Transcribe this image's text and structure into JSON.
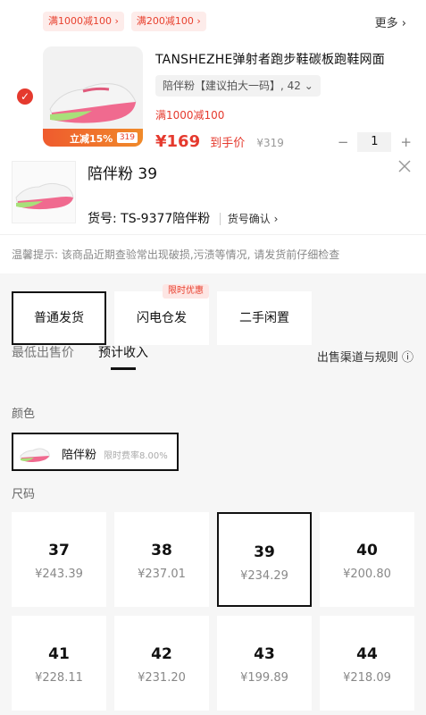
{
  "cart": {
    "coupons": [
      "满1000减100 ›",
      "满200减100 ›"
    ],
    "more_label": "更多 ›",
    "product_title": "TANSHEZHE弹射者跑步鞋碳板跑鞋网面",
    "variant": "陪伴粉【建议拍大一码】, 42 ⌄",
    "promo": "满1000减100",
    "promo_strip": "立减15%",
    "promo_strip_price": "319",
    "price": "¥169",
    "price_label": "到手价",
    "original_price": "¥319",
    "qty_minus": "−",
    "quantity": "1",
    "qty_plus": "+"
  },
  "sheet": {
    "title": "陪伴粉 39",
    "sku_prefix": "货号: ",
    "sku": "TS-9377陪伴粉",
    "sku_confirm": "货号确认 ›",
    "hint": "温馨提示: 该商品近期查验常出现破损,污渍等情况, 请发货前仔细检查",
    "shipping_options": [
      {
        "label": "普通发货",
        "active": true
      },
      {
        "label": "闪电仓发",
        "tag": "限时优惠"
      },
      {
        "label": "二手闲置"
      }
    ],
    "tabs": {
      "lowest_price": "最低出售价",
      "expected_income": "预计收入"
    },
    "rules_link": "出售渠道与规则 ⓘ",
    "color_label": "颜色",
    "color_option": {
      "name": "陪伴粉",
      "fee": "限时费率8.00%"
    },
    "size_label": "尺码",
    "sizes": [
      {
        "size": "37",
        "price": "¥243.39"
      },
      {
        "size": "38",
        "price": "¥237.01"
      },
      {
        "size": "39",
        "price": "¥234.29",
        "selected": true
      },
      {
        "size": "40",
        "price": "¥200.80"
      },
      {
        "size": "41",
        "price": "¥228.11"
      },
      {
        "size": "42",
        "price": "¥231.20"
      },
      {
        "size": "43",
        "price": "¥199.89"
      },
      {
        "size": "44",
        "price": "¥218.09"
      }
    ]
  }
}
